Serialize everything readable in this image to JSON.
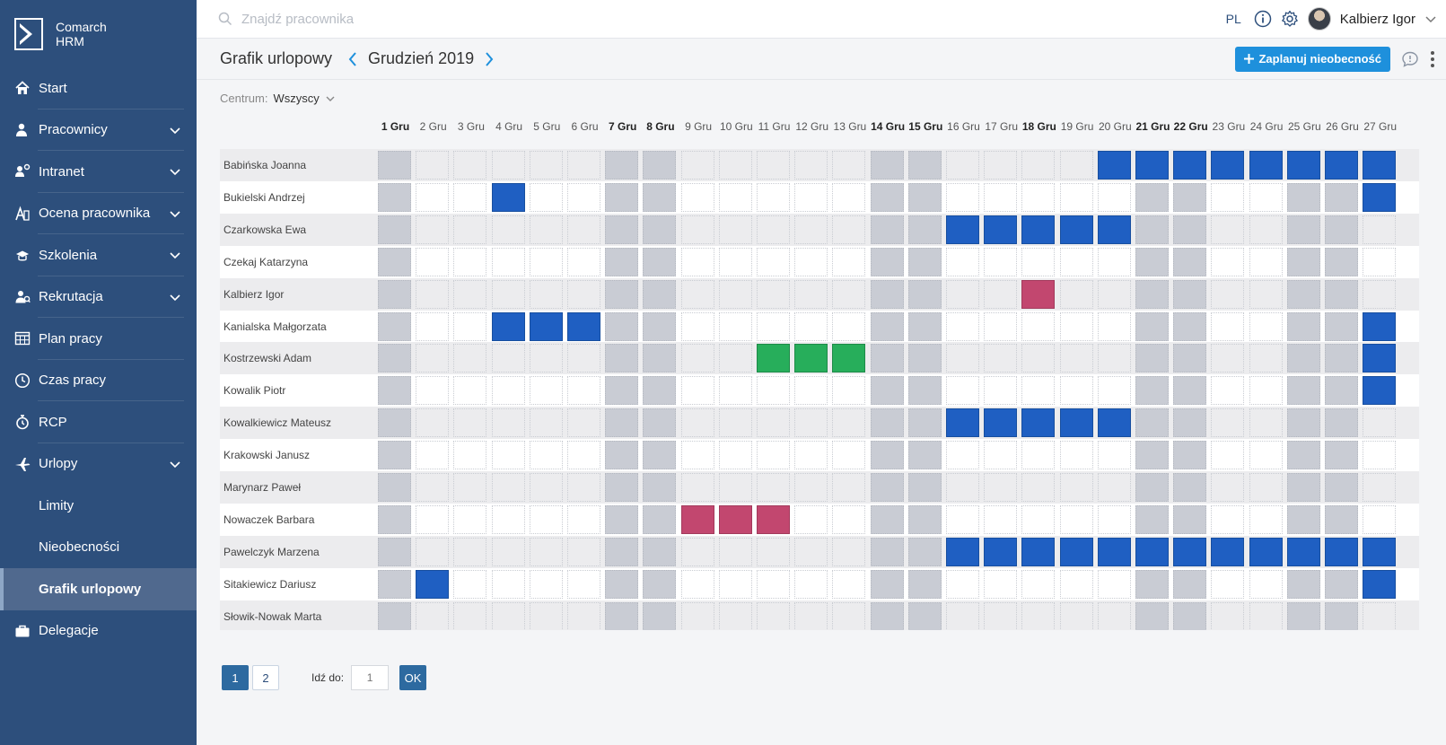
{
  "brand": {
    "line1": "Comarch",
    "line2": "HRM"
  },
  "sidebar": {
    "items": [
      {
        "label": "Start",
        "icon": "home-icon",
        "expandable": false
      },
      {
        "label": "Pracownicy",
        "icon": "users-icon",
        "expandable": true
      },
      {
        "label": "Intranet",
        "icon": "intranet-icon",
        "expandable": true
      },
      {
        "label": "Ocena pracownika",
        "icon": "evaluation-icon",
        "expandable": true
      },
      {
        "label": "Szkolenia",
        "icon": "training-icon",
        "expandable": true
      },
      {
        "label": "Rekrutacja",
        "icon": "recruitment-icon",
        "expandable": true
      },
      {
        "label": "Plan pracy",
        "icon": "calendar-grid-icon",
        "expandable": false
      },
      {
        "label": "Czas pracy",
        "icon": "clock-icon",
        "expandable": false
      },
      {
        "label": "RCP",
        "icon": "stopwatch-icon",
        "expandable": false
      },
      {
        "label": "Urlopy",
        "icon": "plane-icon",
        "expandable": true
      },
      {
        "label": "Limity",
        "icon": "",
        "sub": true
      },
      {
        "label": "Nieobecności",
        "icon": "",
        "sub": true
      },
      {
        "label": "Grafik urlopowy",
        "icon": "",
        "sub": true,
        "active": true
      },
      {
        "label": "Delegacje",
        "icon": "briefcase-icon",
        "expandable": false
      }
    ]
  },
  "topbar": {
    "search_placeholder": "Znajdź pracownika",
    "language": "PL",
    "user_name": "Kalbierz Igor"
  },
  "header": {
    "title": "Grafik urlopowy",
    "month": "Grudzień 2019",
    "plan_button": "Zaplanuj nieobecność"
  },
  "filter": {
    "label": "Centrum:",
    "value": "Wszyscy"
  },
  "colors": {
    "sidebar": "#2d4f7c",
    "accent": "#1e90dc",
    "vacation": "#1f5fc2",
    "training": "#27ae5b",
    "sick": "#c2476f",
    "weekend": "#c9ccd4"
  },
  "calendar": {
    "days": [
      "1 Gru",
      "2 Gru",
      "3 Gru",
      "4 Gru",
      "5 Gru",
      "6 Gru",
      "7 Gru",
      "8 Gru",
      "9 Gru",
      "10 Gru",
      "11 Gru",
      "12 Gru",
      "13 Gru",
      "14 Gru",
      "15 Gru",
      "16 Gru",
      "17 Gru",
      "18 Gru",
      "19 Gru",
      "20 Gru",
      "21 Gru",
      "22 Gru",
      "23 Gru",
      "24 Gru",
      "25 Gru",
      "26 Gru",
      "27 Gru"
    ],
    "bold_days": [
      1,
      7,
      8,
      14,
      15,
      18,
      21,
      22
    ],
    "weekend_days": [
      1,
      7,
      8,
      14,
      15,
      21,
      22,
      25,
      26
    ],
    "employees": [
      {
        "name": "Babińska Joanna",
        "absences": {
          "20": "blue",
          "21": "blue",
          "22": "blue",
          "23": "blue",
          "24": "blue",
          "25": "blue",
          "26": "blue",
          "27": "blue"
        }
      },
      {
        "name": "Bukielski Andrzej",
        "absences": {
          "4": "blue",
          "27": "blue"
        }
      },
      {
        "name": "Czarkowska Ewa",
        "absences": {
          "16": "blue",
          "17": "blue",
          "18": "blue",
          "19": "blue",
          "20": "blue"
        }
      },
      {
        "name": "Czekaj Katarzyna",
        "absences": {}
      },
      {
        "name": "Kalbierz Igor",
        "absences": {
          "18": "pink"
        }
      },
      {
        "name": "Kanialska Małgorzata",
        "absences": {
          "4": "blue",
          "5": "blue",
          "6": "blue",
          "27": "blue"
        }
      },
      {
        "name": "Kostrzewski Adam",
        "absences": {
          "11": "green",
          "12": "green",
          "13": "green",
          "27": "blue"
        }
      },
      {
        "name": "Kowalik Piotr",
        "absences": {
          "27": "blue"
        }
      },
      {
        "name": "Kowalkiewicz Mateusz",
        "absences": {
          "16": "blue",
          "17": "blue",
          "18": "blue",
          "19": "blue",
          "20": "blue"
        }
      },
      {
        "name": "Krakowski Janusz",
        "absences": {}
      },
      {
        "name": "Marynarz Paweł",
        "absences": {}
      },
      {
        "name": "Nowaczek Barbara",
        "absences": {
          "9": "pink",
          "10": "pink",
          "11": "pink"
        }
      },
      {
        "name": "Pawelczyk Marzena",
        "absences": {
          "16": "blue",
          "17": "blue",
          "18": "blue",
          "19": "blue",
          "20": "blue",
          "21": "blue",
          "22": "blue",
          "23": "blue",
          "24": "blue",
          "25": "blue",
          "26": "blue",
          "27": "blue"
        }
      },
      {
        "name": "Sitakiewicz Dariusz",
        "absences": {
          "2": "blue",
          "27": "blue"
        }
      },
      {
        "name": "Słowik-Nowak Marta",
        "absences": {}
      }
    ]
  },
  "pagination": {
    "pages": [
      "1",
      "2"
    ],
    "active_page": "1",
    "goto_label": "Idź do:",
    "goto_placeholder": "1",
    "ok_label": "OK"
  }
}
